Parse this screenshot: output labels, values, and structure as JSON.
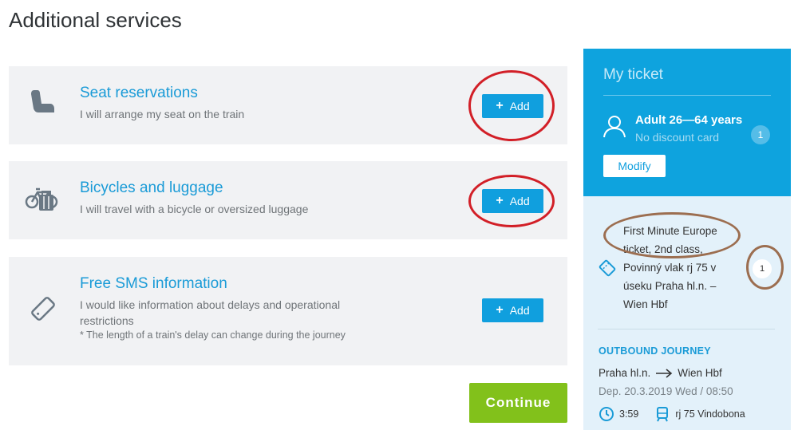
{
  "page": {
    "title": "Additional services"
  },
  "services": [
    {
      "title": "Seat reservations",
      "description": "I will arrange my seat on the train",
      "note": "",
      "add_label": "Add",
      "icon": "seat-icon"
    },
    {
      "title": "Bicycles and luggage",
      "description": "I will travel with a bicycle or oversized luggage",
      "note": "",
      "add_label": "Add",
      "icon": "bicycle-luggage-icon"
    },
    {
      "title": "Free SMS information",
      "description": "I would like information about delays and operational restrictions",
      "note": "* The length of a train's delay can change during the journey",
      "add_label": "Add",
      "icon": "phone-icon"
    }
  ],
  "continue_label": "Continue",
  "ticket": {
    "title": "My ticket",
    "passenger": {
      "name": "Adult 26—64 years",
      "discount": "No discount card",
      "count": "1"
    },
    "modify_label": "Modify",
    "fare": {
      "text": "First Minute Europe ticket, 2nd class, Povinný vlak rj 75 v úseku Praha hl.n. – Wien Hbf",
      "count": "1"
    },
    "outbound": {
      "label": "OUTBOUND JOURNEY",
      "from": "Praha hl.n.",
      "to": "Wien Hbf",
      "departure": "Dep. 20.3.2019 Wed / 08:50",
      "duration": "3:59",
      "train": "rj 75 Vindobona"
    }
  },
  "colors": {
    "accent": "#109fde",
    "continue": "#82c11b",
    "card_bg": "#f1f2f4",
    "annotation_red": "#d21f27",
    "annotation_brown": "#9c6e50"
  }
}
